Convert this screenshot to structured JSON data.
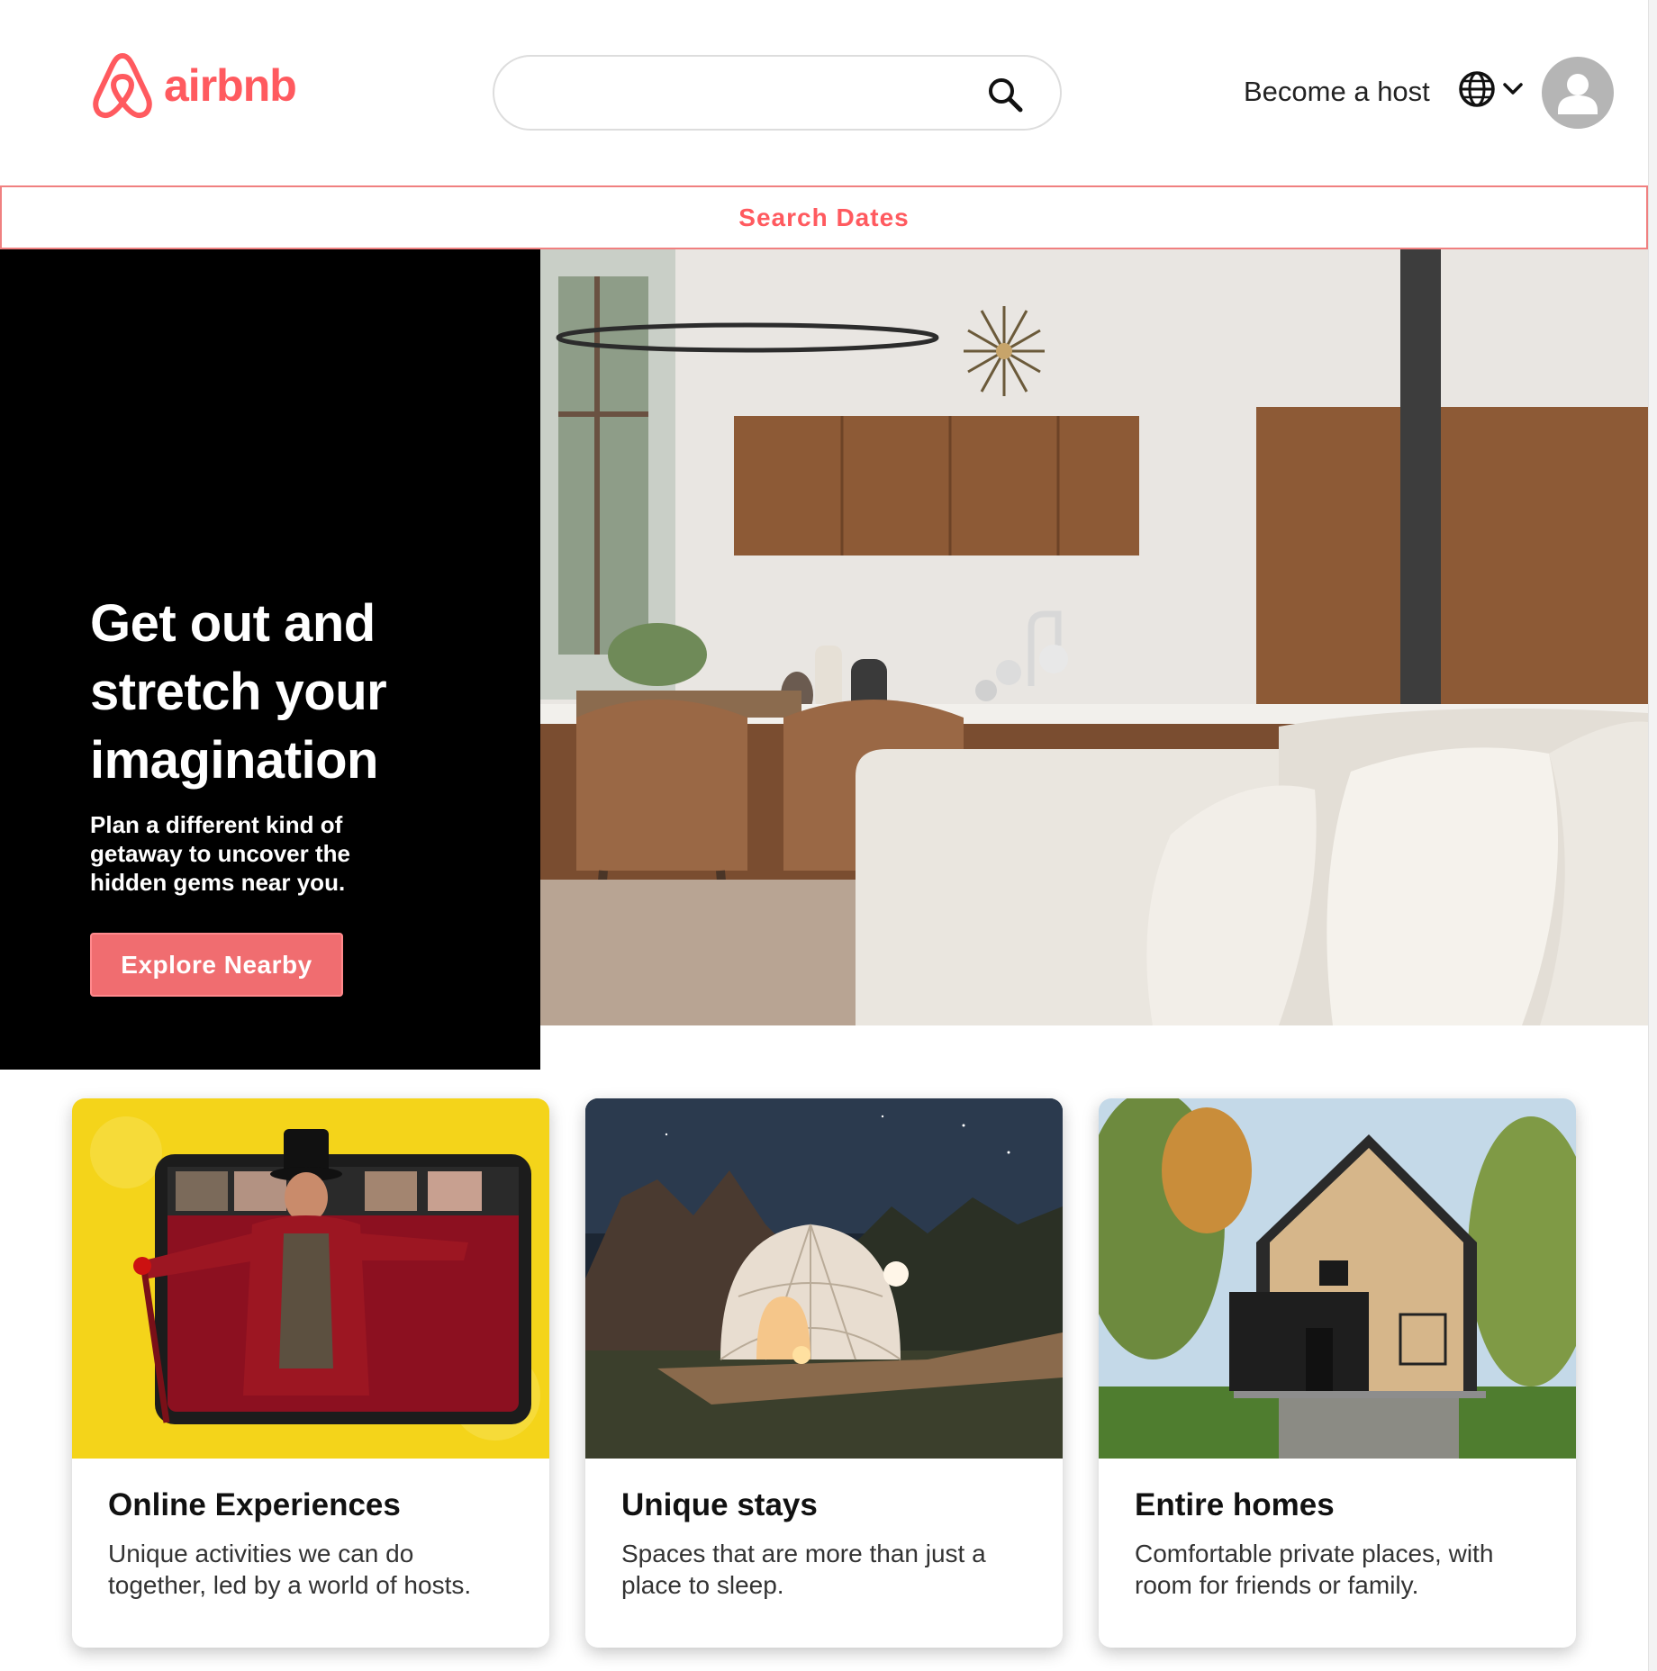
{
  "header": {
    "logo_text": "airbnb",
    "search_placeholder": "",
    "host_link": "Become a host"
  },
  "dates_bar": {
    "label": "Search Dates"
  },
  "hero": {
    "title": "Get out and stretch your imagination",
    "subtitle": "Plan a different kind of getaway to uncover the hidden gems near you.",
    "button": "Explore Nearby"
  },
  "cards": [
    {
      "title": "Online Experiences",
      "description": "Unique activities we can do together, led by a world of hosts."
    },
    {
      "title": "Unique stays",
      "description": "Spaces that are more than just a place to sleep."
    },
    {
      "title": "Entire homes",
      "description": "Comfortable private places, with room for friends or family."
    }
  ],
  "icons": {
    "logo": "airbnb-belo-icon",
    "search": "search-icon",
    "language": "globe-icon",
    "dropdown": "chevron-down-icon",
    "profile": "user-avatar-icon"
  },
  "colors": {
    "brand": "#ff5a5f",
    "button": "#f06d70",
    "hero_panel": "#000000"
  }
}
